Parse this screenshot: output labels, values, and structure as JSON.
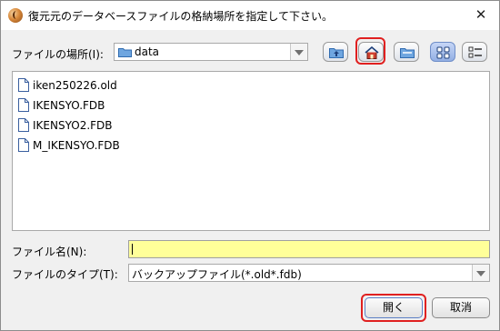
{
  "window": {
    "title": "復元元のデータベースファイルの格納場所を指定して下さい。",
    "close_label": "✕"
  },
  "lookin": {
    "label": "ファイルの場所(I):",
    "value": "data"
  },
  "toolbar": {
    "icons": [
      "up-folder-icon",
      "home-icon",
      "new-folder-icon",
      "list-view-icon",
      "details-view-icon"
    ]
  },
  "files": [
    {
      "name": "iken250226.old"
    },
    {
      "name": "IKENSYO.FDB"
    },
    {
      "name": "IKENSYO2.FDB"
    },
    {
      "name": "M_IKENSYO.FDB"
    }
  ],
  "filename": {
    "label": "ファイル名(N):",
    "value": ""
  },
  "filetype": {
    "label": "ファイルのタイプ(T):",
    "value": "バックアップファイル(*.old*.fdb)"
  },
  "buttons": {
    "open": "開く",
    "cancel": "取消"
  },
  "colors": {
    "highlight": "#e02020",
    "filename_bg": "#ffff99",
    "selected_view": "#93afe4"
  }
}
